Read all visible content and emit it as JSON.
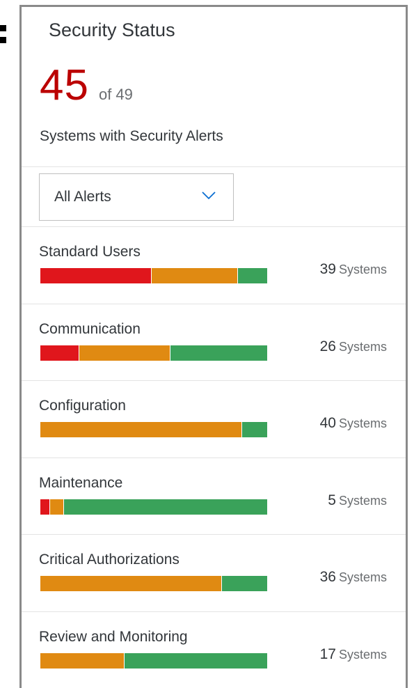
{
  "card": {
    "title": "Security Status",
    "kpi_value": "45",
    "kpi_of": "of 49",
    "subtitle": "Systems with Security Alerts"
  },
  "filter": {
    "selected": "All Alerts"
  },
  "colors": {
    "high": "#e0161c",
    "medium": "#e08a12",
    "ok": "#3aa25a",
    "kpi": "#bb0000"
  },
  "categories": [
    {
      "label": "Standard Users",
      "count": "39",
      "unit": "Systems",
      "breakdown": {
        "high": 0.49,
        "medium": 0.38,
        "ok": 0.13
      }
    },
    {
      "label": "Communication",
      "count": "26",
      "unit": "Systems",
      "breakdown": {
        "high": 0.17,
        "medium": 0.4,
        "ok": 0.43
      }
    },
    {
      "label": "Configuration",
      "count": "40",
      "unit": "Systems",
      "breakdown": {
        "high": 0.0,
        "medium": 0.89,
        "ok": 0.11
      }
    },
    {
      "label": "Maintenance",
      "count": "5",
      "unit": "Systems",
      "breakdown": {
        "high": 0.04,
        "medium": 0.06,
        "ok": 0.9
      }
    },
    {
      "label": "Critical Authorizations",
      "count": "36",
      "unit": "Systems",
      "breakdown": {
        "high": 0.0,
        "medium": 0.8,
        "ok": 0.2
      }
    },
    {
      "label": "Review and Monitoring",
      "count": "17",
      "unit": "Systems",
      "breakdown": {
        "high": 0.0,
        "medium": 0.37,
        "ok": 0.63
      }
    }
  ]
}
